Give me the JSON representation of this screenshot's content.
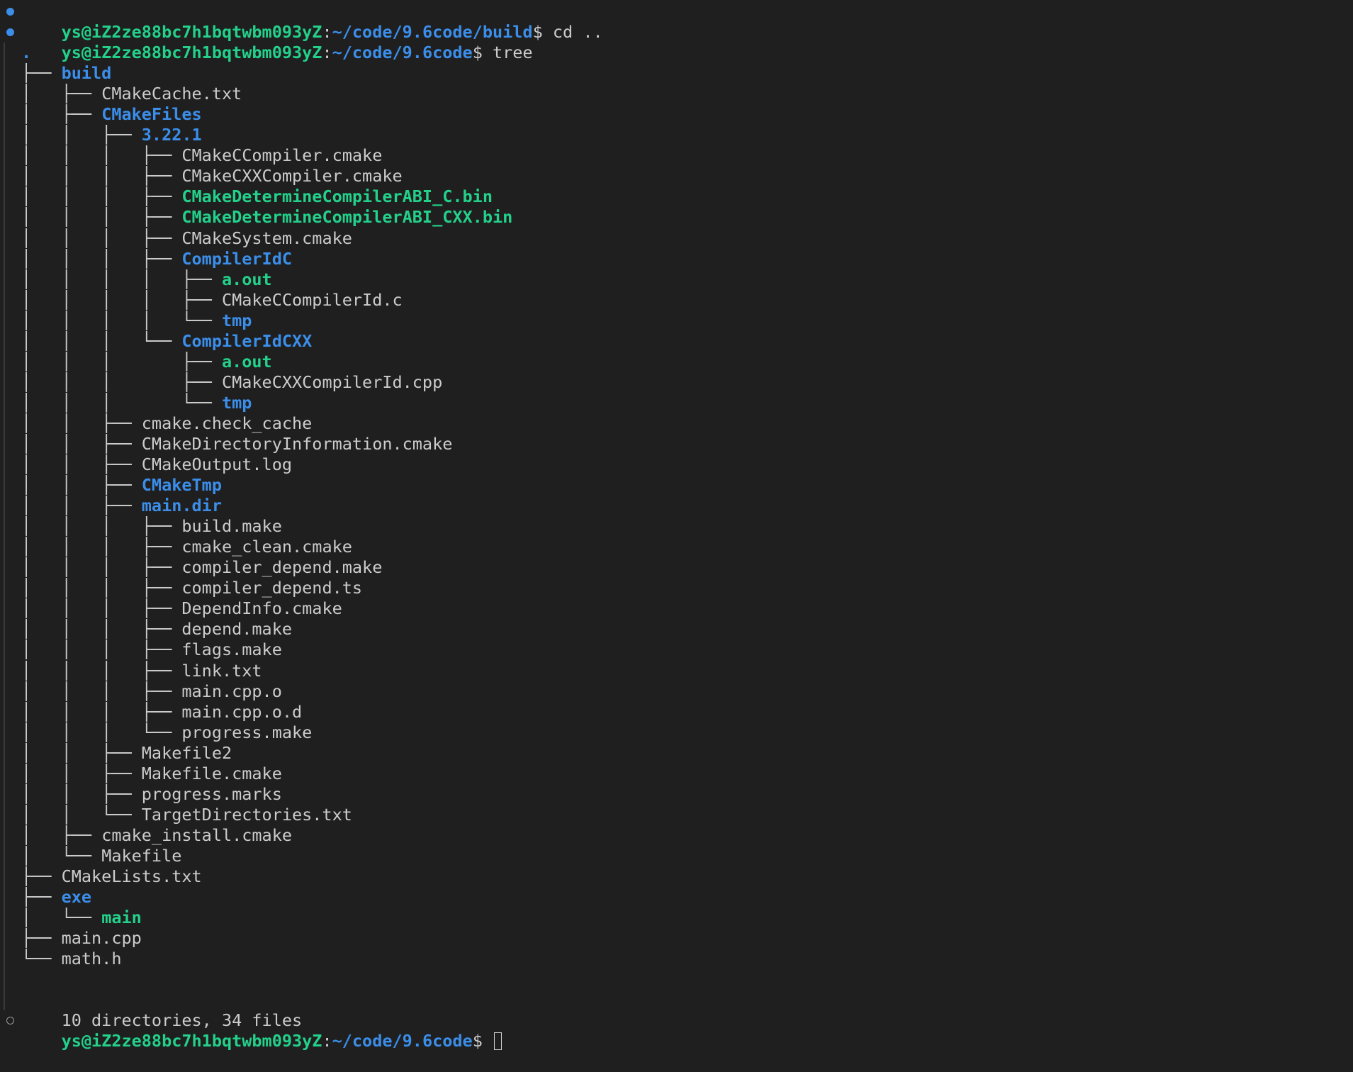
{
  "prompt": {
    "user_host": "ys@iZ2ze88bc7h1bqtwbm093yZ",
    "colon": ":",
    "dollar": "$"
  },
  "history": [
    {
      "path": "~/code/9.6code/build",
      "command": " cd .."
    },
    {
      "path": "~/code/9.6code",
      "command": " tree"
    }
  ],
  "tree": [
    {
      "prefix": "",
      "name": ".",
      "kind": "dir"
    },
    {
      "prefix": "├── ",
      "name": "build",
      "kind": "dir"
    },
    {
      "prefix": "│   ├── ",
      "name": "CMakeCache.txt",
      "kind": "file"
    },
    {
      "prefix": "│   ├── ",
      "name": "CMakeFiles",
      "kind": "dir"
    },
    {
      "prefix": "│   │   ├── ",
      "name": "3.22.1",
      "kind": "dir"
    },
    {
      "prefix": "│   │   │   ├── ",
      "name": "CMakeCCompiler.cmake",
      "kind": "file"
    },
    {
      "prefix": "│   │   │   ├── ",
      "name": "CMakeCXXCompiler.cmake",
      "kind": "file"
    },
    {
      "prefix": "│   │   │   ├── ",
      "name": "CMakeDetermineCompilerABI_C.bin",
      "kind": "exe"
    },
    {
      "prefix": "│   │   │   ├── ",
      "name": "CMakeDetermineCompilerABI_CXX.bin",
      "kind": "exe"
    },
    {
      "prefix": "│   │   │   ├── ",
      "name": "CMakeSystem.cmake",
      "kind": "file"
    },
    {
      "prefix": "│   │   │   ├── ",
      "name": "CompilerIdC",
      "kind": "dir"
    },
    {
      "prefix": "│   │   │   │   ├── ",
      "name": "a.out",
      "kind": "exe"
    },
    {
      "prefix": "│   │   │   │   ├── ",
      "name": "CMakeCCompilerId.c",
      "kind": "file"
    },
    {
      "prefix": "│   │   │   │   └── ",
      "name": "tmp",
      "kind": "dir"
    },
    {
      "prefix": "│   │   │   └── ",
      "name": "CompilerIdCXX",
      "kind": "dir"
    },
    {
      "prefix": "│   │   │       ├── ",
      "name": "a.out",
      "kind": "exe"
    },
    {
      "prefix": "│   │   │       ├── ",
      "name": "CMakeCXXCompilerId.cpp",
      "kind": "file"
    },
    {
      "prefix": "│   │   │       └── ",
      "name": "tmp",
      "kind": "dir"
    },
    {
      "prefix": "│   │   ├── ",
      "name": "cmake.check_cache",
      "kind": "file"
    },
    {
      "prefix": "│   │   ├── ",
      "name": "CMakeDirectoryInformation.cmake",
      "kind": "file"
    },
    {
      "prefix": "│   │   ├── ",
      "name": "CMakeOutput.log",
      "kind": "file"
    },
    {
      "prefix": "│   │   ├── ",
      "name": "CMakeTmp",
      "kind": "dir"
    },
    {
      "prefix": "│   │   ├── ",
      "name": "main.dir",
      "kind": "dir"
    },
    {
      "prefix": "│   │   │   ├── ",
      "name": "build.make",
      "kind": "file"
    },
    {
      "prefix": "│   │   │   ├── ",
      "name": "cmake_clean.cmake",
      "kind": "file"
    },
    {
      "prefix": "│   │   │   ├── ",
      "name": "compiler_depend.make",
      "kind": "file"
    },
    {
      "prefix": "│   │   │   ├── ",
      "name": "compiler_depend.ts",
      "kind": "file"
    },
    {
      "prefix": "│   │   │   ├── ",
      "name": "DependInfo.cmake",
      "kind": "file"
    },
    {
      "prefix": "│   │   │   ├── ",
      "name": "depend.make",
      "kind": "file"
    },
    {
      "prefix": "│   │   │   ├── ",
      "name": "flags.make",
      "kind": "file"
    },
    {
      "prefix": "│   │   │   ├── ",
      "name": "link.txt",
      "kind": "file"
    },
    {
      "prefix": "│   │   │   ├── ",
      "name": "main.cpp.o",
      "kind": "file"
    },
    {
      "prefix": "│   │   │   ├── ",
      "name": "main.cpp.o.d",
      "kind": "file"
    },
    {
      "prefix": "│   │   │   └── ",
      "name": "progress.make",
      "kind": "file"
    },
    {
      "prefix": "│   │   ├── ",
      "name": "Makefile2",
      "kind": "file"
    },
    {
      "prefix": "│   │   ├── ",
      "name": "Makefile.cmake",
      "kind": "file"
    },
    {
      "prefix": "│   │   ├── ",
      "name": "progress.marks",
      "kind": "file"
    },
    {
      "prefix": "│   │   └── ",
      "name": "TargetDirectories.txt",
      "kind": "file"
    },
    {
      "prefix": "│   ├── ",
      "name": "cmake_install.cmake",
      "kind": "file"
    },
    {
      "prefix": "│   └── ",
      "name": "Makefile",
      "kind": "file"
    },
    {
      "prefix": "├── ",
      "name": "CMakeLists.txt",
      "kind": "file"
    },
    {
      "prefix": "├── ",
      "name": "exe",
      "kind": "dir"
    },
    {
      "prefix": "│   └── ",
      "name": "main",
      "kind": "exe"
    },
    {
      "prefix": "├── ",
      "name": "main.cpp",
      "kind": "file"
    },
    {
      "prefix": "└── ",
      "name": "math.h",
      "kind": "file"
    }
  ],
  "summary": "10 directories, 34 files",
  "current_prompt": {
    "path": "~/code/9.6code"
  },
  "colors": {
    "background": "#1f1f1f",
    "user": "#23d18b",
    "path": "#3b8eea",
    "directory": "#3b8eea",
    "executable": "#23d18b",
    "text": "#cccccc"
  }
}
